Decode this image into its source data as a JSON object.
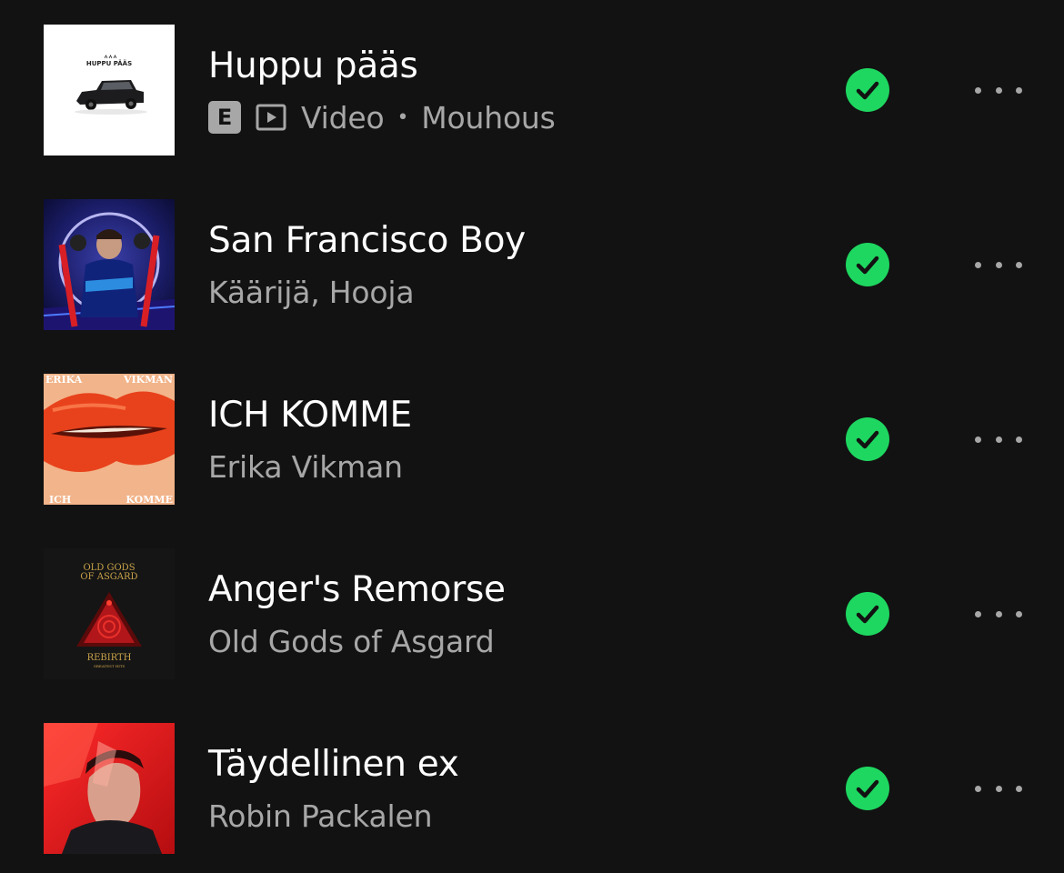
{
  "tracks": [
    {
      "title": "Huppu pääs",
      "explicit": true,
      "explicit_label": "E",
      "type_icon": "video-play-icon",
      "type_label": "Video",
      "separator": "•",
      "artist": "Mouhous",
      "art_text": "HUPPU PÄÄS",
      "downloaded": true
    },
    {
      "title": "San Francisco Boy",
      "artist": "Käärijä, Hooja",
      "downloaded": true
    },
    {
      "title": "ICH KOMME",
      "artist": "Erika Vikman",
      "art_text_top_left": "ERIKA",
      "art_text_top_right": "VIKMAN",
      "art_text_bottom_left": "ICH",
      "art_text_bottom_right": "KOMME",
      "downloaded": true
    },
    {
      "title": "Anger's Remorse",
      "artist": "Old Gods of Asgard",
      "art_text_line1": "OLD GODS",
      "art_text_line2": "OF ASGARD",
      "art_text_bottom": "REBIRTH",
      "art_text_small": "GREATEST HITS",
      "downloaded": true
    },
    {
      "title": "Täydellinen ex",
      "artist": "Robin Packalen",
      "downloaded": true
    }
  ],
  "colors": {
    "background": "#121212",
    "title": "#ffffff",
    "subtitle": "#a7a7a7",
    "downloaded_green": "#1ed760"
  },
  "icons": {
    "downloaded": "check-circle-icon",
    "more": "more-options-icon"
  }
}
